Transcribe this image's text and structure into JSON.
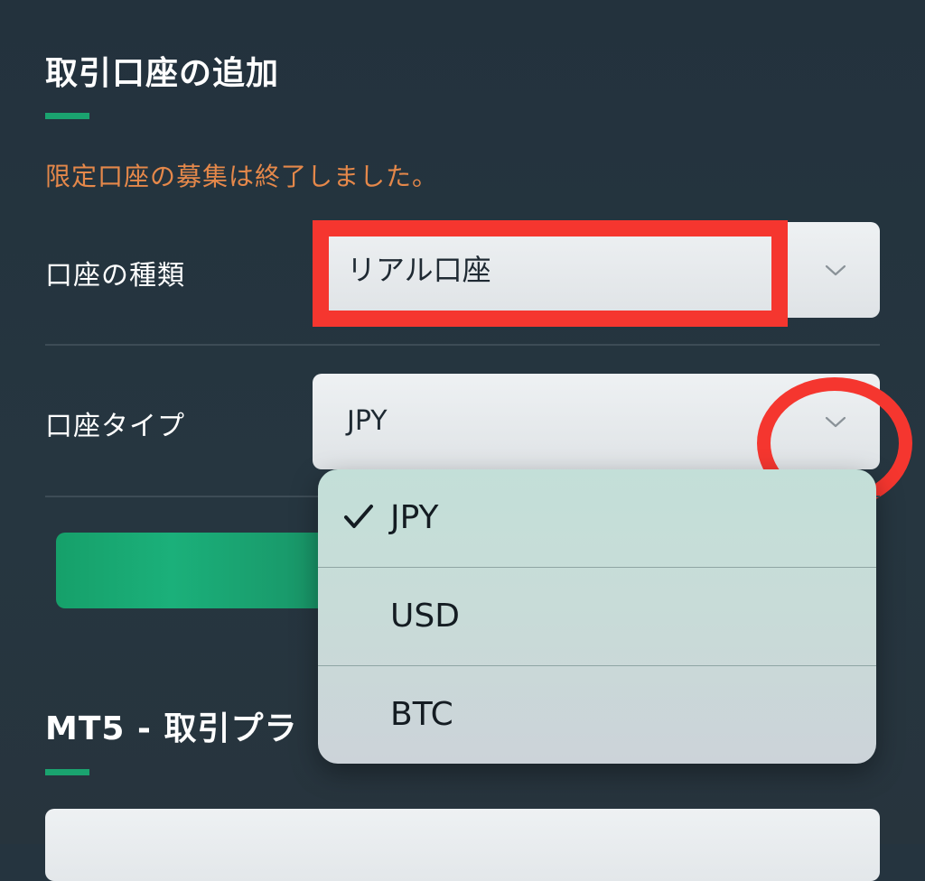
{
  "section1": {
    "title": "取引口座の追加",
    "notice": "限定口座の募集は終了しました。"
  },
  "account_kind": {
    "label": "口座の種類",
    "value": "リアル口座"
  },
  "account_type": {
    "label": "口座タイプ",
    "value": "JPY",
    "options": [
      {
        "label": "JPY",
        "selected": true
      },
      {
        "label": "USD",
        "selected": false
      },
      {
        "label": "BTC",
        "selected": false
      }
    ]
  },
  "section2": {
    "title": "MT5 - 取引プラ"
  },
  "colors": {
    "background": "#25343f",
    "accent": "#1aa36f",
    "notice": "#e5884a",
    "annotation": "#f5362f"
  },
  "icons": {
    "select_chevron": "chevron-down-icon",
    "selected_mark": "checkmark-icon"
  }
}
